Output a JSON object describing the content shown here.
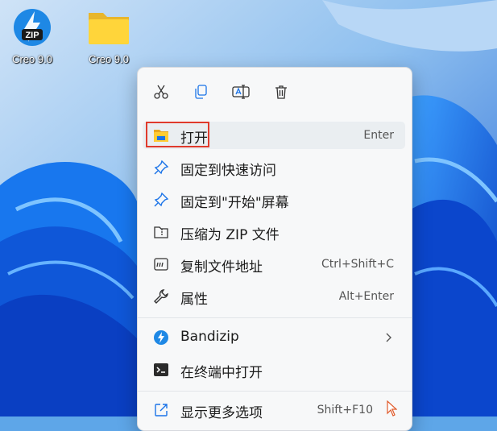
{
  "desktop": {
    "icons": [
      {
        "label": "Creo 9.0",
        "icon": "zip-archive-icon",
        "badge": "ZIP"
      },
      {
        "label": "Creo 9.0",
        "icon": "folder-icon"
      }
    ]
  },
  "context_menu": {
    "toolbar": [
      {
        "name": "cut",
        "icon": "scissors-icon"
      },
      {
        "name": "copy",
        "icon": "copy-icon"
      },
      {
        "name": "rename",
        "icon": "rename-icon"
      },
      {
        "name": "delete",
        "icon": "trash-icon"
      }
    ],
    "items": [
      {
        "label": "打开",
        "shortcut": "Enter",
        "icon": "folder-open-icon"
      },
      {
        "label": "固定到快速访问",
        "shortcut": "",
        "icon": "pin-icon"
      },
      {
        "label": "固定到\"开始\"屏幕",
        "shortcut": "",
        "icon": "pin-icon"
      },
      {
        "label": "压缩为 ZIP 文件",
        "shortcut": "",
        "icon": "zip-folder-icon"
      },
      {
        "label": "复制文件地址",
        "shortcut": "Ctrl+Shift+C",
        "icon": "copy-path-icon"
      },
      {
        "label": "属性",
        "shortcut": "Alt+Enter",
        "icon": "wrench-icon"
      },
      {
        "label": "Bandizip",
        "shortcut": "",
        "icon": "bandizip-icon"
      },
      {
        "label": "在终端中打开",
        "shortcut": "",
        "icon": "terminal-icon"
      },
      {
        "label": "显示更多选项",
        "shortcut": "Shift+F10",
        "icon": "external-icon"
      }
    ],
    "colors": {
      "highlight_border": "#e03a2c",
      "accent": "#1a73e8",
      "menu_background": "#f7f8f9"
    }
  }
}
